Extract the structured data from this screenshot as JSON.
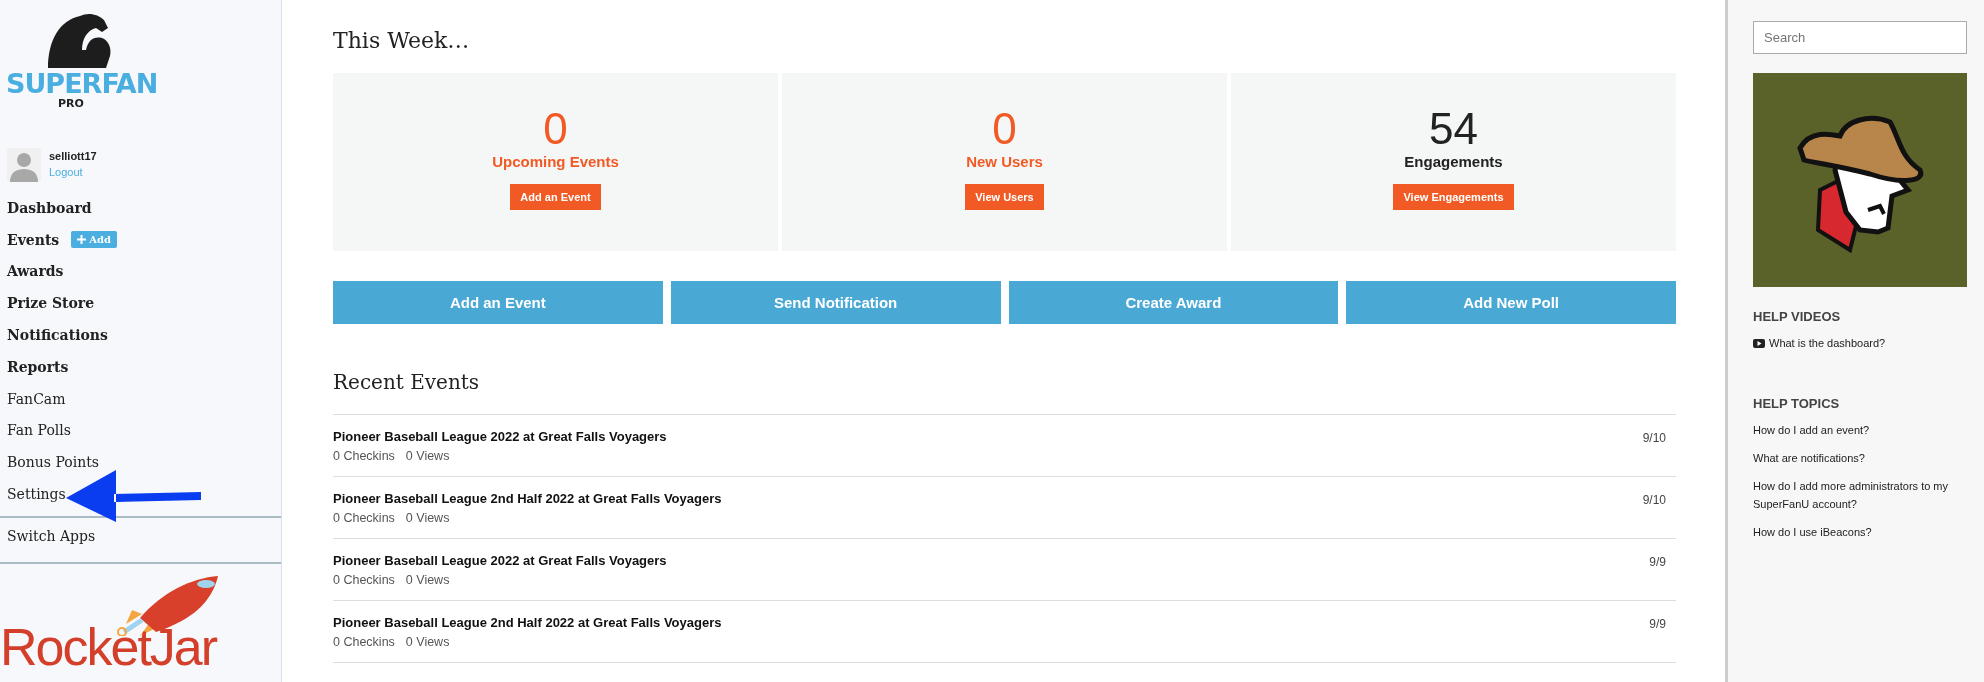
{
  "sidebar": {
    "logo": {
      "wordmark": "SUPERFAN",
      "subtitle": "PRO"
    },
    "user": {
      "name": "selliott17",
      "logout": "Logout"
    },
    "nav": [
      {
        "label": "Dashboard",
        "kind": "section"
      },
      {
        "label": "Events",
        "kind": "section",
        "badge": "Add"
      },
      {
        "label": "Awards",
        "kind": "section"
      },
      {
        "label": "Prize Store",
        "kind": "section"
      },
      {
        "label": "Notifications",
        "kind": "section"
      },
      {
        "label": "Reports",
        "kind": "section"
      },
      {
        "label": "FanCam",
        "kind": "link"
      },
      {
        "label": "Fan Polls",
        "kind": "link"
      },
      {
        "label": "Bonus Points",
        "kind": "link"
      },
      {
        "label": "Settings",
        "kind": "link"
      }
    ],
    "switch": "Switch Apps",
    "footer_logo": "RocketJar"
  },
  "main": {
    "title": "This Week…",
    "stats": [
      {
        "value": "0",
        "label": "Upcoming Events",
        "button": "Add an Event",
        "color": "#f15a24"
      },
      {
        "value": "0",
        "label": "New Users",
        "button": "View Users",
        "color": "#f15a24"
      },
      {
        "value": "54",
        "label": "Engagements",
        "button": "View Engagements",
        "color": "#222222"
      }
    ],
    "actions": [
      "Add an Event",
      "Send Notification",
      "Create Award",
      "Add New Poll"
    ],
    "recent_title": "Recent Events",
    "events": [
      {
        "name": "Pioneer Baseball League 2022 at Great Falls Voyagers",
        "checkins": "0 Checkins",
        "views": "0 Views",
        "date": "9/10"
      },
      {
        "name": "Pioneer Baseball League 2nd Half 2022 at Great Falls Voyagers",
        "checkins": "0 Checkins",
        "views": "0 Views",
        "date": "9/10"
      },
      {
        "name": "Pioneer Baseball League 2022 at Great Falls Voyagers",
        "checkins": "0 Checkins",
        "views": "0 Views",
        "date": "9/9"
      },
      {
        "name": "Pioneer Baseball League 2nd Half 2022 at Great Falls Voyagers",
        "checkins": "0 Checkins",
        "views": "0 Views",
        "date": "9/9"
      }
    ]
  },
  "right": {
    "search": {
      "placeholder": "Search"
    },
    "help_videos": {
      "title": "HELP VIDEOS",
      "items": [
        "What is the dashboard?"
      ]
    },
    "help_topics": {
      "title": "HELP TOPICS",
      "items": [
        "How do I add an event?",
        "What are notifications?",
        "How do I add more administrators to my SuperFanU account?",
        "How do I use iBeacons?"
      ]
    }
  }
}
